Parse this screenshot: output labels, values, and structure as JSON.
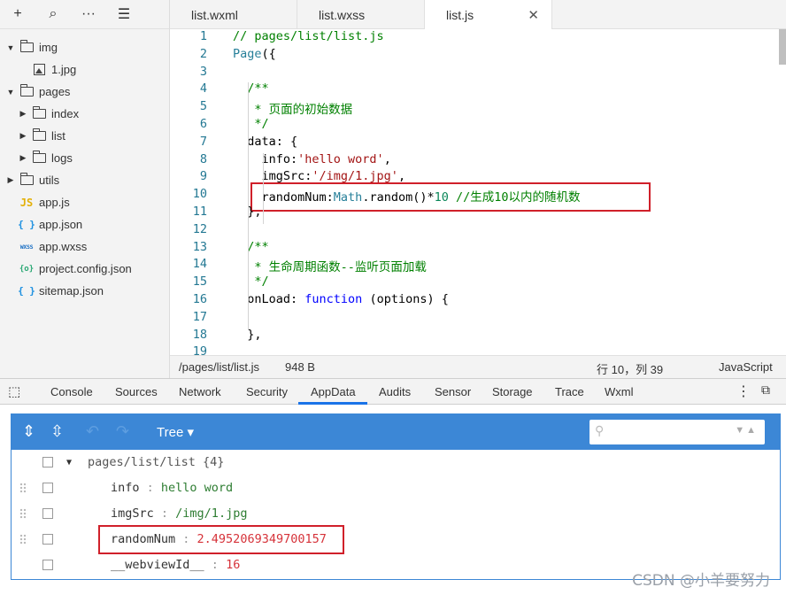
{
  "toolbar": {
    "add": "+",
    "search": "⌕",
    "more": "···",
    "collapse": "☰"
  },
  "file_tree": [
    {
      "label": "img",
      "indent": 1,
      "type": "folder",
      "expanded": true
    },
    {
      "label": "1.jpg",
      "indent": 2,
      "type": "image"
    },
    {
      "label": "pages",
      "indent": 1,
      "type": "folder",
      "expanded": true
    },
    {
      "label": "index",
      "indent": 2,
      "type": "folder",
      "expanded": false
    },
    {
      "label": "list",
      "indent": 2,
      "type": "folder",
      "expanded": false
    },
    {
      "label": "logs",
      "indent": 2,
      "type": "folder",
      "expanded": false
    },
    {
      "label": "utils",
      "indent": 1,
      "type": "folder",
      "expanded": false
    },
    {
      "label": "app.js",
      "indent": 1,
      "type": "js",
      "badge": "JS"
    },
    {
      "label": "app.json",
      "indent": 1,
      "type": "json",
      "badge": "{ }"
    },
    {
      "label": "app.wxss",
      "indent": 1,
      "type": "wxss",
      "badge": "WXSS"
    },
    {
      "label": "project.config.json",
      "indent": 1,
      "type": "config",
      "badge": "{o}"
    },
    {
      "label": "sitemap.json",
      "indent": 1,
      "type": "json",
      "badge": "{ }"
    }
  ],
  "editor_tabs": [
    {
      "label": "list.wxml",
      "active": false
    },
    {
      "label": "list.wxss",
      "active": false
    },
    {
      "label": "list.js",
      "active": true
    }
  ],
  "code_lines": [
    {
      "n": "1",
      "tokens": [
        [
          "c-com",
          "// pages/list/list.js"
        ]
      ]
    },
    {
      "n": "2",
      "tokens": [
        [
          "c-id",
          "Page"
        ],
        [
          "",
          "({"
        ]
      ]
    },
    {
      "n": "3",
      "tokens": []
    },
    {
      "n": "4",
      "tokens": [
        [
          "c-com",
          "  /**"
        ]
      ]
    },
    {
      "n": "5",
      "tokens": [
        [
          "c-com",
          "   * 页面的初始数据"
        ]
      ]
    },
    {
      "n": "6",
      "tokens": [
        [
          "c-com",
          "   */"
        ]
      ]
    },
    {
      "n": "7",
      "tokens": [
        [
          "",
          "  data: {"
        ]
      ]
    },
    {
      "n": "8",
      "tokens": [
        [
          "",
          "    info:"
        ],
        [
          "c-str",
          "'hello word'"
        ],
        [
          "",
          ","
        ]
      ]
    },
    {
      "n": "9",
      "tokens": [
        [
          "",
          "    imgSrc:"
        ],
        [
          "c-str",
          "'/img/1.jpg'"
        ],
        [
          "",
          ","
        ]
      ]
    },
    {
      "n": "10",
      "tokens": [
        [
          "",
          "    randomNum:"
        ],
        [
          "c-id",
          "Math"
        ],
        [
          "",
          ".random()*"
        ],
        [
          "c-num",
          "10"
        ],
        [
          "c-com",
          " //生成10以内的随机数"
        ]
      ]
    },
    {
      "n": "11",
      "tokens": [
        [
          "",
          "  },"
        ]
      ]
    },
    {
      "n": "12",
      "tokens": []
    },
    {
      "n": "13",
      "tokens": [
        [
          "c-com",
          "  /**"
        ]
      ]
    },
    {
      "n": "14",
      "tokens": [
        [
          "c-com",
          "   * 生命周期函数--监听页面加载"
        ]
      ]
    },
    {
      "n": "15",
      "tokens": [
        [
          "c-com",
          "   */"
        ]
      ]
    },
    {
      "n": "16",
      "tokens": [
        [
          "",
          "  onLoad: "
        ],
        [
          "c-kw",
          "function"
        ],
        [
          "",
          " (options) {"
        ]
      ]
    },
    {
      "n": "17",
      "tokens": []
    },
    {
      "n": "18",
      "tokens": [
        [
          "",
          "  },"
        ]
      ]
    },
    {
      "n": "19",
      "tokens": []
    }
  ],
  "status": {
    "path": "/pages/list/list.js",
    "size": "948 B",
    "cursor": "行 10，列 39",
    "language": "JavaScript"
  },
  "devtools_tabs": [
    "Console",
    "Sources",
    "Network",
    "Security",
    "AppData",
    "Audits",
    "Sensor",
    "Storage",
    "Trace",
    "Wxml"
  ],
  "devtools_active": "AppData",
  "appdata": {
    "view_mode": "Tree",
    "header": "pages/list/list {4}",
    "rows": [
      {
        "key": "info",
        "value": "hello word",
        "kind": "string"
      },
      {
        "key": "imgSrc",
        "value": "/img/1.jpg",
        "kind": "string"
      },
      {
        "key": "randomNum",
        "value": "2.4952069349700157",
        "kind": "number"
      },
      {
        "key": "__webviewId__",
        "value": "16",
        "kind": "number"
      }
    ]
  },
  "watermark": "CSDN @小羊要努力",
  "colors": {
    "highlight_box": "#d0202a",
    "panel_blue": "#3c87d6",
    "active_tab_underline": "#1a73e8"
  }
}
